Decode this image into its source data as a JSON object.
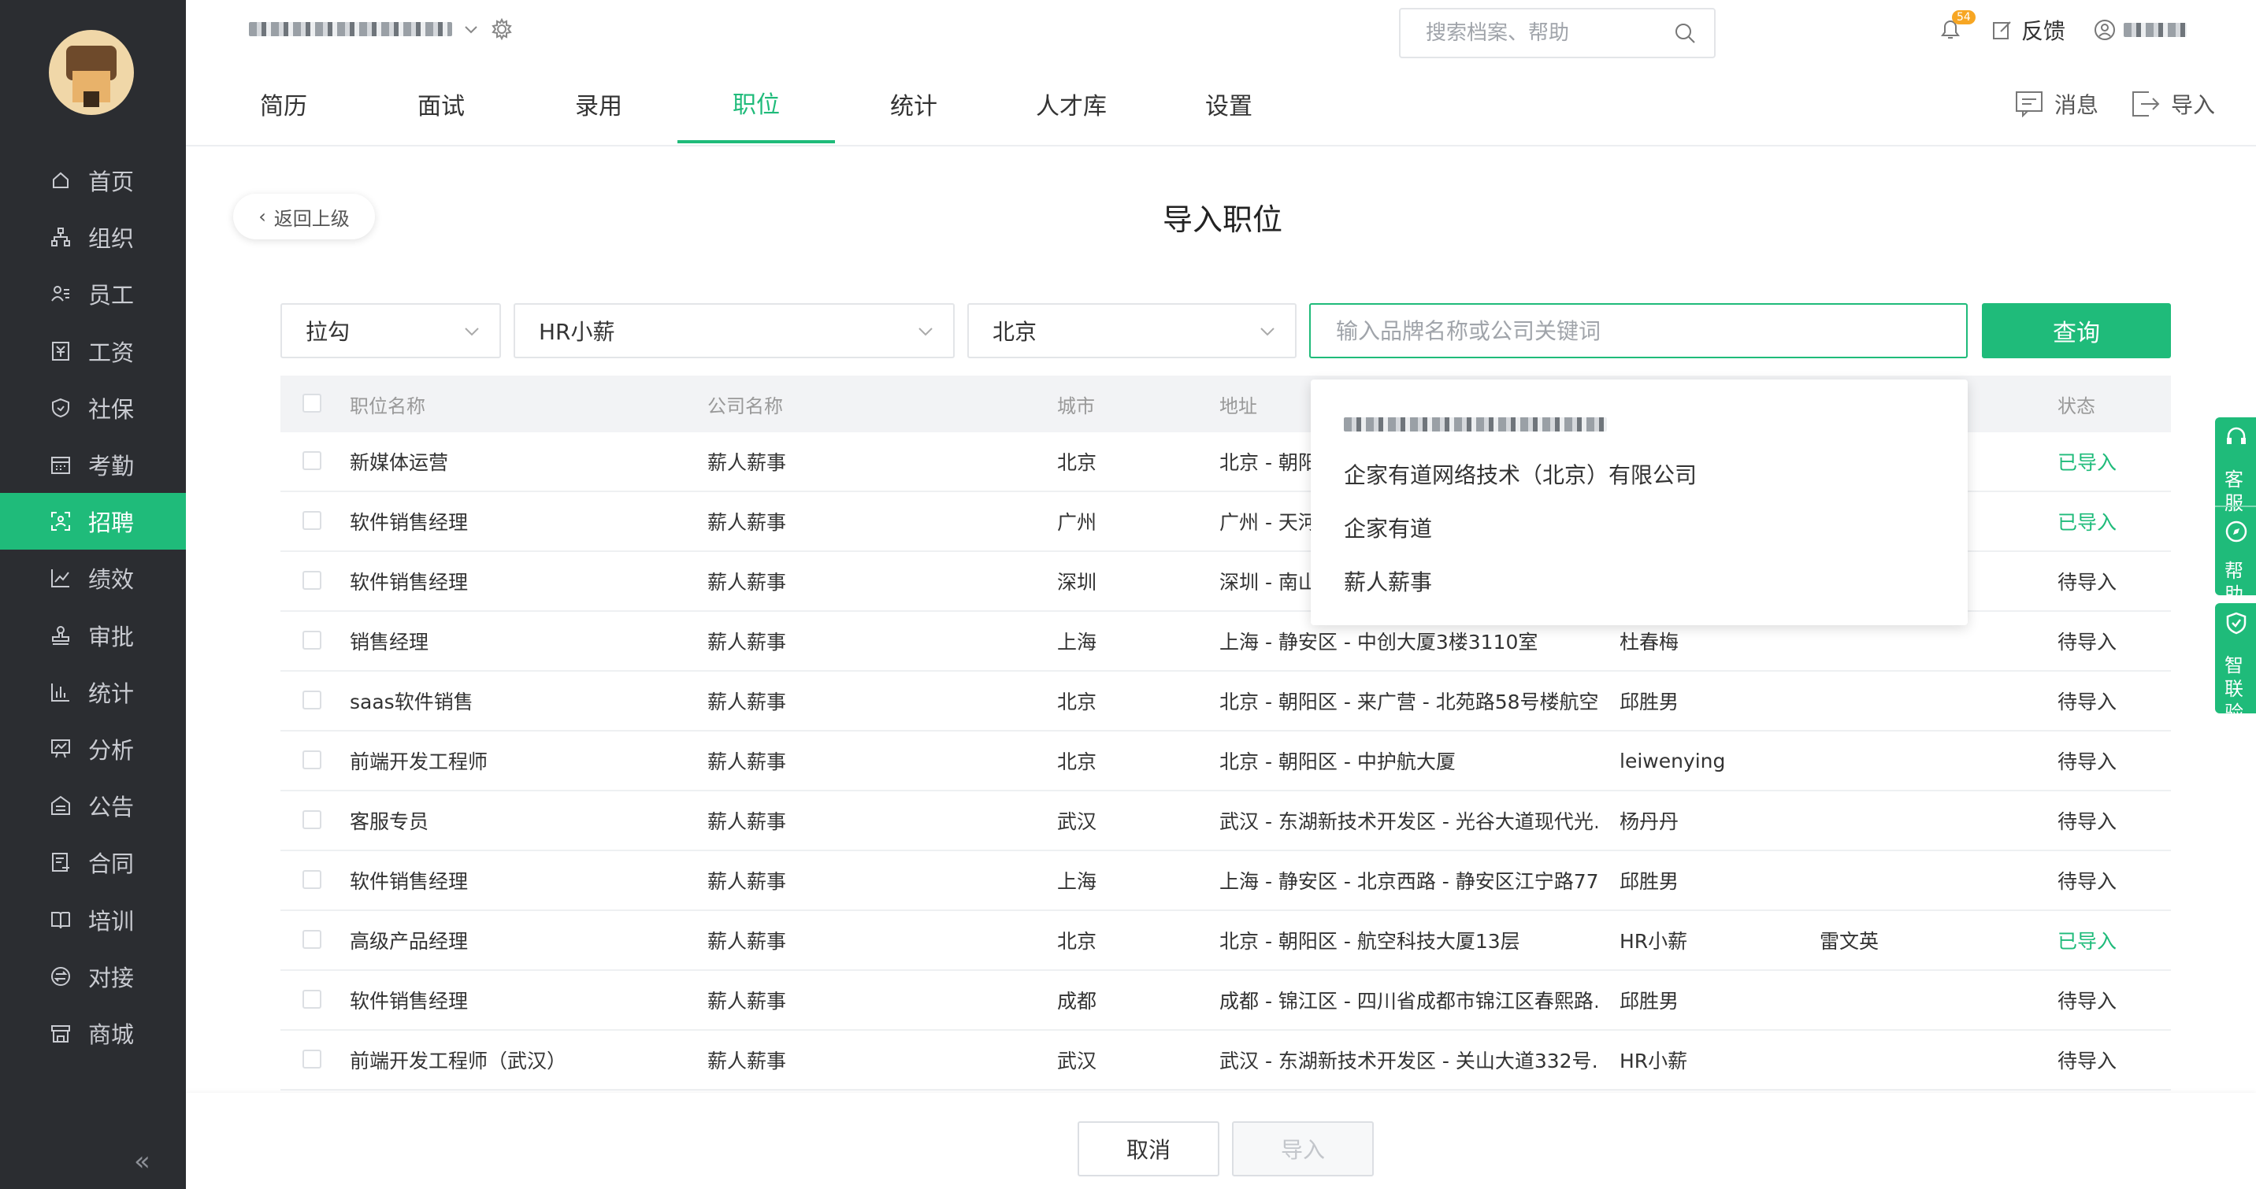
{
  "sidebar": {
    "items": [
      {
        "label": "首页",
        "icon": "home-icon"
      },
      {
        "label": "组织",
        "icon": "org-icon"
      },
      {
        "label": "员工",
        "icon": "staff-icon"
      },
      {
        "label": "工资",
        "icon": "salary-icon"
      },
      {
        "label": "社保",
        "icon": "shield-icon"
      },
      {
        "label": "考勤",
        "icon": "calendar-icon"
      },
      {
        "label": "招聘",
        "icon": "recruit-icon"
      },
      {
        "label": "绩效",
        "icon": "chart-line-icon"
      },
      {
        "label": "审批",
        "icon": "stamp-icon"
      },
      {
        "label": "统计",
        "icon": "bar-chart-icon"
      },
      {
        "label": "分析",
        "icon": "analysis-icon"
      },
      {
        "label": "公告",
        "icon": "notice-icon"
      },
      {
        "label": "合同",
        "icon": "contract-icon"
      },
      {
        "label": "培训",
        "icon": "book-icon"
      },
      {
        "label": "对接",
        "icon": "link-icon"
      },
      {
        "label": "商城",
        "icon": "shop-icon"
      }
    ],
    "active_index": 6
  },
  "header": {
    "search_placeholder": "搜索档案、帮助",
    "notification_count": "54",
    "feedback_label": "反馈"
  },
  "tabs": [
    "简历",
    "面试",
    "录用",
    "职位",
    "统计",
    "人才库",
    "设置"
  ],
  "active_tab": 3,
  "tab_actions": {
    "message": "消息",
    "import": "导入"
  },
  "back_label": "返回上级",
  "page_title": "导入职位",
  "filters": {
    "source": "拉勾",
    "account": "HR小薪",
    "city": "北京",
    "keyword_placeholder": "输入品牌名称或公司关键词",
    "query_label": "查询"
  },
  "table": {
    "headers": {
      "name": "职位名称",
      "company": "公司名称",
      "city": "城市",
      "address": "地址",
      "status": "状态"
    },
    "rows": [
      {
        "name": "新媒体运营",
        "company": "薪人薪事",
        "city": "北京",
        "address": "北京 - 朝阳",
        "contact": "",
        "owner": "",
        "status": "已导入"
      },
      {
        "name": "软件销售经理",
        "company": "薪人薪事",
        "city": "广州",
        "address": "广州 - 天河",
        "contact": "",
        "owner": "",
        "status": "已导入"
      },
      {
        "name": "软件销售经理",
        "company": "薪人薪事",
        "city": "深圳",
        "address": "深圳 - 南山",
        "contact": "",
        "owner": "",
        "status": "待导入"
      },
      {
        "name": "销售经理",
        "company": "薪人薪事",
        "city": "上海",
        "address": "上海 - 静安区 - 中创大厦3楼3110室",
        "contact": "杜春梅",
        "owner": "",
        "status": "待导入"
      },
      {
        "name": "saas软件销售",
        "company": "薪人薪事",
        "city": "北京",
        "address": "北京 - 朝阳区 - 来广营 - 北苑路58号楼航空…",
        "contact": "邱胜男",
        "owner": "",
        "status": "待导入"
      },
      {
        "name": "前端开发工程师",
        "company": "薪人薪事",
        "city": "北京",
        "address": "北京 - 朝阳区 - 中护航大厦",
        "contact": "leiwenying",
        "owner": "",
        "status": "待导入"
      },
      {
        "name": "客服专员",
        "company": "薪人薪事",
        "city": "武汉",
        "address": "武汉 - 东湖新技术开发区 - 光谷大道现代光…",
        "contact": "杨丹丹",
        "owner": "",
        "status": "待导入"
      },
      {
        "name": "软件销售经理",
        "company": "薪人薪事",
        "city": "上海",
        "address": "上海 - 静安区 - 北京西路 - 静安区江宁路77…",
        "contact": "邱胜男",
        "owner": "",
        "status": "待导入"
      },
      {
        "name": "高级产品经理",
        "company": "薪人薪事",
        "city": "北京",
        "address": "北京 - 朝阳区 - 航空科技大厦13层",
        "contact": "HR小薪",
        "owner": "雷文英",
        "status": "已导入"
      },
      {
        "name": "软件销售经理",
        "company": "薪人薪事",
        "city": "成都",
        "address": "成都 - 锦江区 - 四川省成都市锦江区春熙路…",
        "contact": "邱胜男",
        "owner": "",
        "status": "待导入"
      },
      {
        "name": "前端开发工程师（武汉）",
        "company": "薪人薪事",
        "city": "武汉",
        "address": "武汉 - 东湖新技术开发区 - 关山大道332号…",
        "contact": "HR小薪",
        "owner": "",
        "status": "待导入"
      }
    ]
  },
  "dropdown": {
    "items": [
      "企家有道网络技术（北京）有限公司",
      "企家有道",
      "薪人薪事"
    ]
  },
  "side_float": {
    "service": "客服",
    "help": "帮助",
    "verify": "智联验证"
  },
  "footer": {
    "cancel": "取消",
    "import": "导入"
  },
  "colors": {
    "brand": "#1fbb7a",
    "sidebar": "#2b2d31",
    "badge": "#f7a623"
  }
}
